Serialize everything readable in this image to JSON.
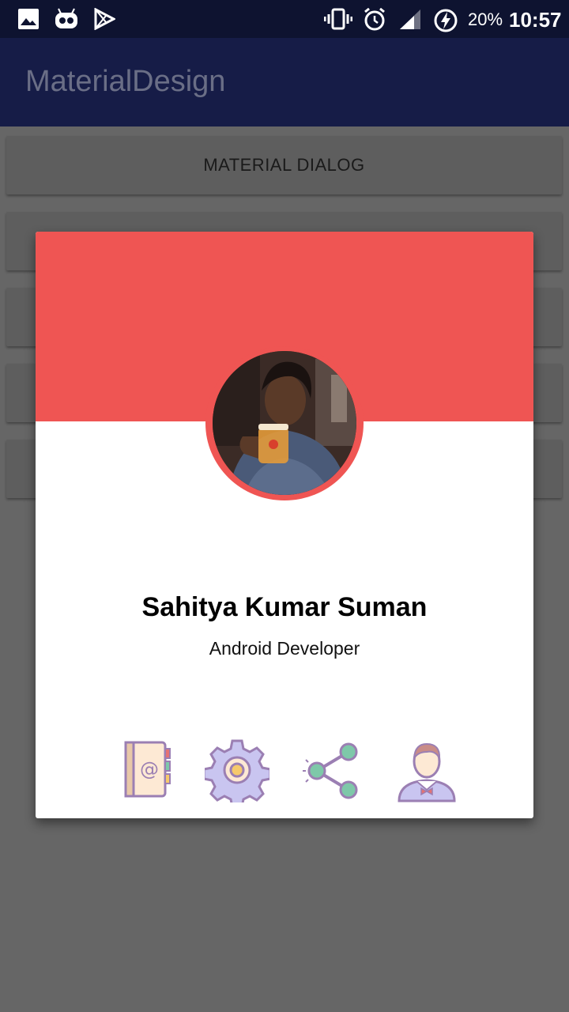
{
  "status_bar": {
    "battery_percent": "20%",
    "time": "10:57",
    "icons": [
      "image-icon",
      "android-robot-icon",
      "play-store-icon",
      "vibrate-icon",
      "alarm-icon",
      "signal-icon",
      "battery-charging-icon"
    ]
  },
  "app_bar": {
    "title": "MaterialDesign"
  },
  "buttons": [
    {
      "label": "MATERIAL DIALOG"
    },
    {
      "label": ""
    },
    {
      "label": ""
    },
    {
      "label": ""
    },
    {
      "label": ""
    }
  ],
  "dialog": {
    "header_color": "#ef5553",
    "name": "Sahitya Kumar Suman",
    "role": "Android Developer",
    "actions": [
      {
        "icon": "contact-book-icon"
      },
      {
        "icon": "settings-gear-icon"
      },
      {
        "icon": "share-icon"
      },
      {
        "icon": "profile-person-icon"
      }
    ]
  }
}
